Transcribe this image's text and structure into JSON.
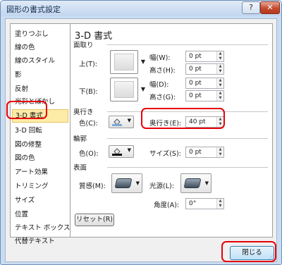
{
  "window": {
    "title": "図形の書式設定",
    "help_label": "?",
    "close_label": "✕"
  },
  "sidebar": {
    "items": [
      {
        "label": "塗りつぶし"
      },
      {
        "label": "線の色"
      },
      {
        "label": "線のスタイル"
      },
      {
        "label": "影"
      },
      {
        "label": "反射"
      },
      {
        "label": "光彩とぼかし"
      },
      {
        "label": "3-D 書式"
      },
      {
        "label": "3-D 回転"
      },
      {
        "label": "図の修整"
      },
      {
        "label": "図の色"
      },
      {
        "label": "アート効果"
      },
      {
        "label": "トリミング"
      },
      {
        "label": "サイズ"
      },
      {
        "label": "位置"
      },
      {
        "label": "テキスト ボックス"
      },
      {
        "label": "代替テキスト"
      }
    ],
    "selected": "3-D 書式"
  },
  "panel": {
    "title": "3-D 書式",
    "bevel": {
      "section": "面取り",
      "top_label": "上(T):",
      "bottom_label": "下(B):",
      "top_width_label": "幅(W):",
      "top_width": "0 pt",
      "top_height_label": "高さ(H):",
      "top_height": "0 pt",
      "bottom_width_label": "幅(D):",
      "bottom_width": "0 pt",
      "bottom_height_label": "高さ(G):",
      "bottom_height": "0 pt"
    },
    "depth": {
      "section": "奥行き",
      "color_label": "色(C):",
      "depth_label": "奥行き(E):",
      "depth_value": "40 pt"
    },
    "contour": {
      "section": "輪郭",
      "color_label": "色(O):",
      "size_label": "サイズ(S):",
      "size_value": "0 pt"
    },
    "surface": {
      "section": "表面",
      "material_label": "質感(M):",
      "lighting_label": "光源(L):",
      "angle_label": "角度(A):",
      "angle_value": "0°"
    },
    "reset_label": "リセット(R)"
  },
  "footer": {
    "close_label": "閉じる"
  },
  "colors": {
    "accent_highlight": "#e8000a",
    "selected_item": "#fdeba8"
  }
}
